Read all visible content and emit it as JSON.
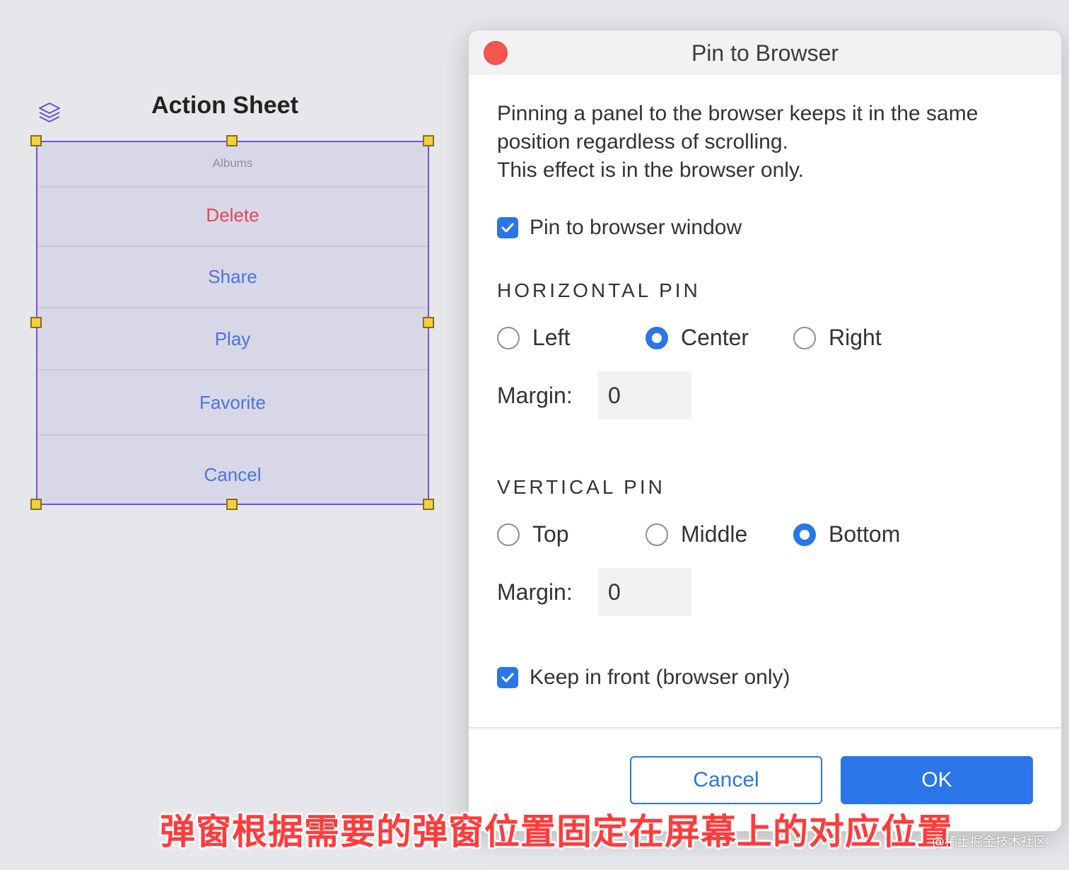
{
  "action_sheet": {
    "title": "Action Sheet",
    "header": "Albums",
    "items": [
      "Delete",
      "Share",
      "Play",
      "Favorite"
    ],
    "cancel": "Cancel",
    "danger_color": "#e0475b",
    "accent_color": "#4b74e2",
    "selection_color": "#7a4ee0"
  },
  "dialog": {
    "title": "Pin to Browser",
    "description_lines": [
      "Pinning a panel to the browser keeps it in the same",
      "position regardless of scrolling.",
      "This effect is in the browser only."
    ],
    "pin_checkbox": {
      "label": "Pin to browser window",
      "checked": true
    },
    "horizontal": {
      "title": "HORIZONTAL PIN",
      "options": [
        "Left",
        "Center",
        "Right"
      ],
      "selected": "Center",
      "margin_label": "Margin:",
      "margin_value": "0"
    },
    "vertical": {
      "title": "VERTICAL PIN",
      "options": [
        "Top",
        "Middle",
        "Bottom"
      ],
      "selected": "Bottom",
      "margin_label": "Margin:",
      "margin_value": "0"
    },
    "front_checkbox": {
      "label": "Keep in front (browser only)",
      "checked": true
    },
    "buttons": {
      "cancel": "Cancel",
      "ok": "OK"
    },
    "accent_color": "#2a75e8",
    "close_color": "#f2564f"
  },
  "caption": "弹窗根据需要的弹窗位置固定在屏幕上的对应位置",
  "watermark": "@稀土掘金技术社区"
}
